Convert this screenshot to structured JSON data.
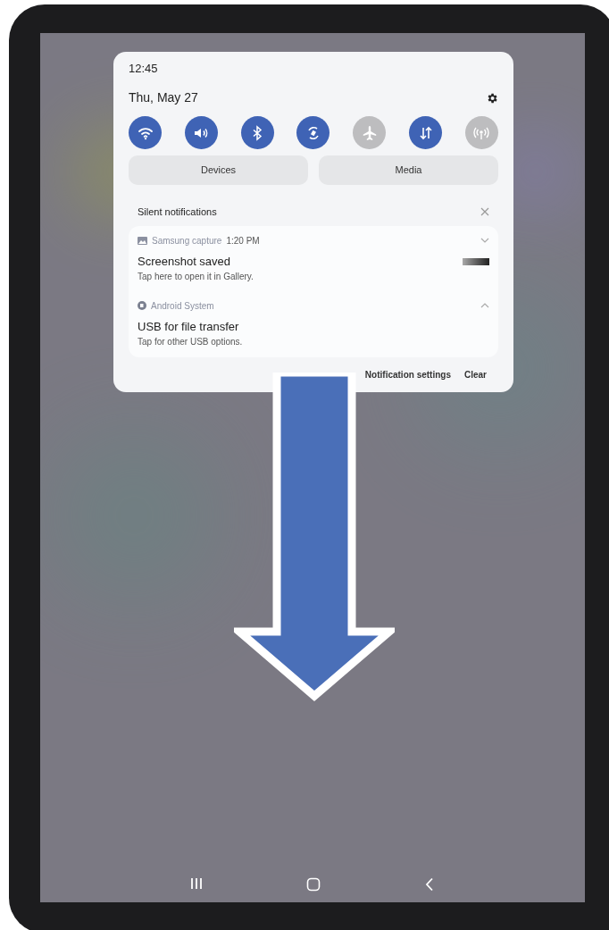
{
  "panel": {
    "time": "12:45",
    "date": "Thu, May 27",
    "toggles": [
      {
        "kind": "wifi",
        "on": true
      },
      {
        "kind": "sound",
        "on": true
      },
      {
        "kind": "bluetooth",
        "on": true
      },
      {
        "kind": "rotate",
        "on": true
      },
      {
        "kind": "airplane",
        "on": false
      },
      {
        "kind": "data",
        "on": true
      },
      {
        "kind": "hotspot",
        "on": false
      }
    ],
    "buttons": [
      "Devices",
      "Media"
    ],
    "section_title": "Silent notifications",
    "notifications": [
      {
        "kind": "image",
        "app": "Samsung capture",
        "time": "1:20 PM",
        "title": "Screenshot saved",
        "text": "Tap here to open it in Gallery.",
        "expanded": false
      },
      {
        "kind": "system",
        "app": "Android System",
        "title": "USB for file transfer",
        "text": "Tap for other USB options.",
        "expanded": true
      }
    ],
    "footer": [
      "Notification settings",
      "Clear"
    ]
  }
}
